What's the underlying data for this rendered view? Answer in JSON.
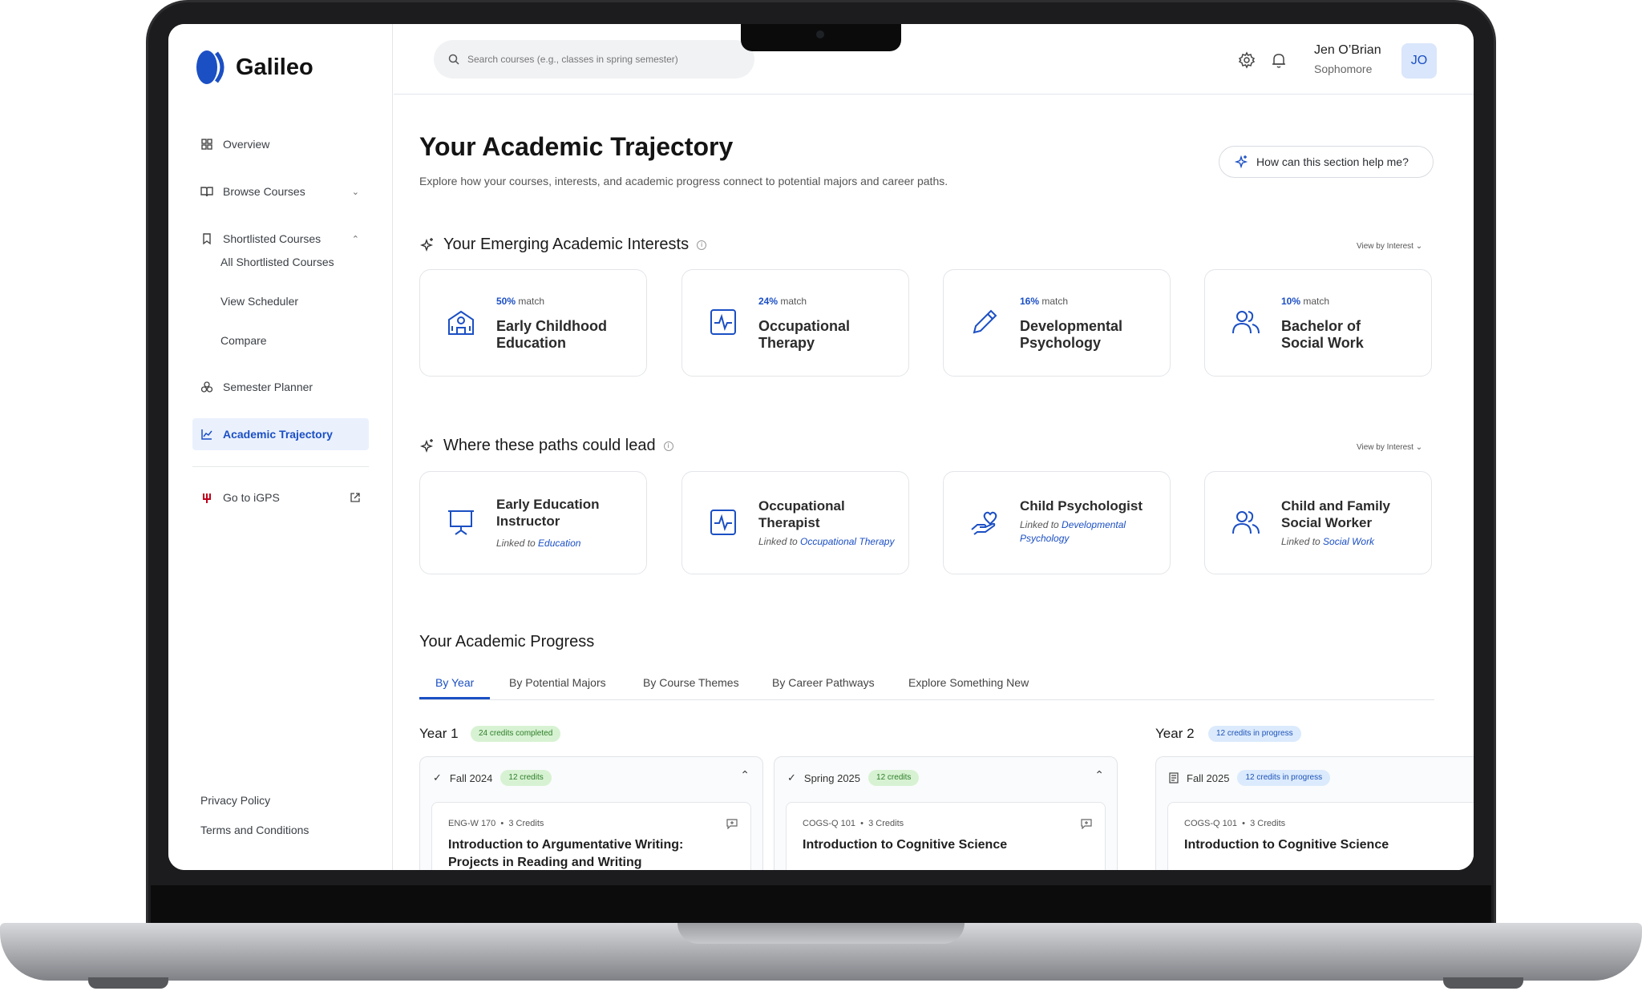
{
  "app": {
    "name": "Galileo",
    "accent": "#1b4fc4"
  },
  "sidebar": {
    "items": [
      {
        "label": "Overview",
        "icon": "grid-icon"
      },
      {
        "label": "Browse Courses",
        "icon": "book-icon"
      },
      {
        "label": "Shortlisted Courses",
        "icon": "bookmark-icon"
      },
      {
        "label": "All Shortlisted Courses"
      },
      {
        "label": "View Scheduler"
      },
      {
        "label": "Compare"
      },
      {
        "label": "Semester Planner",
        "icon": "cubes-icon"
      },
      {
        "label": "Academic Trajectory",
        "icon": "chart-line-icon"
      },
      {
        "label": "Go to iGPS",
        "icon": "trident-icon"
      }
    ],
    "footer": {
      "privacy": "Privacy Policy",
      "terms": "Terms and Conditions"
    }
  },
  "topbar": {
    "search_placeholder": "Search courses (e.g., classes in spring semester)",
    "user_name": "Jen O’Brian",
    "user_role": "Sophomore",
    "avatar_initials": "JO"
  },
  "page": {
    "title": "Your Academic Trajectory",
    "subtitle": "Explore how your courses, interests, and academic progress connect to potential majors and career paths.",
    "help_button": "How can this section help me?"
  },
  "interests": {
    "title": "Your Emerging Academic Interests",
    "view_by": "View by Interest",
    "cards": [
      {
        "pct": "50%",
        "match_word": "match",
        "line1": "Early Childhood",
        "line2": "Education",
        "icon": "school-icon"
      },
      {
        "pct": "24%",
        "match_word": "match",
        "line1": "Occupational",
        "line2": "Therapy",
        "icon": "pulse-icon"
      },
      {
        "pct": "16%",
        "match_word": "match",
        "line1": "Developmental",
        "line2": "Psychology",
        "icon": "pencil-icon"
      },
      {
        "pct": "10%",
        "match_word": "match",
        "line1": "Bachelor of",
        "line2": "Social Work",
        "icon": "users-icon"
      }
    ]
  },
  "paths": {
    "title": "Where these paths could lead",
    "view_by": "View by Interest",
    "cards": [
      {
        "line1": "Early Education",
        "line2": "Instructor",
        "linked_prefix": "Linked to",
        "linked": "Education",
        "icon": "presentation-icon"
      },
      {
        "line1": "Occupational",
        "line2": "Therapist",
        "linked_prefix": "Linked to",
        "linked": "Occupational Therapy",
        "icon": "pulse-icon"
      },
      {
        "line1": "Child Psychologist",
        "line2": "",
        "linked_prefix": "Linked to",
        "linked": "Developmental",
        "linked2": "Psychology",
        "icon": "heart-hand-icon"
      },
      {
        "line1": "Child and Family",
        "line2": "Social Worker",
        "linked_prefix": "Linked to",
        "linked": "Social Work",
        "icon": "users-icon"
      }
    ]
  },
  "progress": {
    "title": "Your Academic Progress",
    "tabs": [
      "By Year",
      "By Potential Majors",
      "By Course Themes",
      "By Career Pathways",
      "Explore Something New"
    ],
    "years": [
      {
        "label": "Year 1",
        "badge": "24 credits completed"
      },
      {
        "label": "Year 2",
        "badge": "12 credits in progress"
      }
    ],
    "semesters": [
      {
        "term": "Fall 2024",
        "badge": "12 credits",
        "code": "ENG-W 170",
        "credits": "3 Credits",
        "title1": "Introduction to Argumentative Writing:",
        "title2": "Projects in Reading and Writing"
      },
      {
        "term": "Spring 2025",
        "badge": "12 credits",
        "code": "COGS-Q 101",
        "credits": "3 Credits",
        "title1": "Introduction to Cognitive Science",
        "title2": ""
      },
      {
        "term": "Fall 2025",
        "badge": "12 credits in progress",
        "code": "COGS-Q 101",
        "credits": "3 Credits",
        "title1": "Introduction to Cognitive Science",
        "title2": ""
      }
    ]
  }
}
